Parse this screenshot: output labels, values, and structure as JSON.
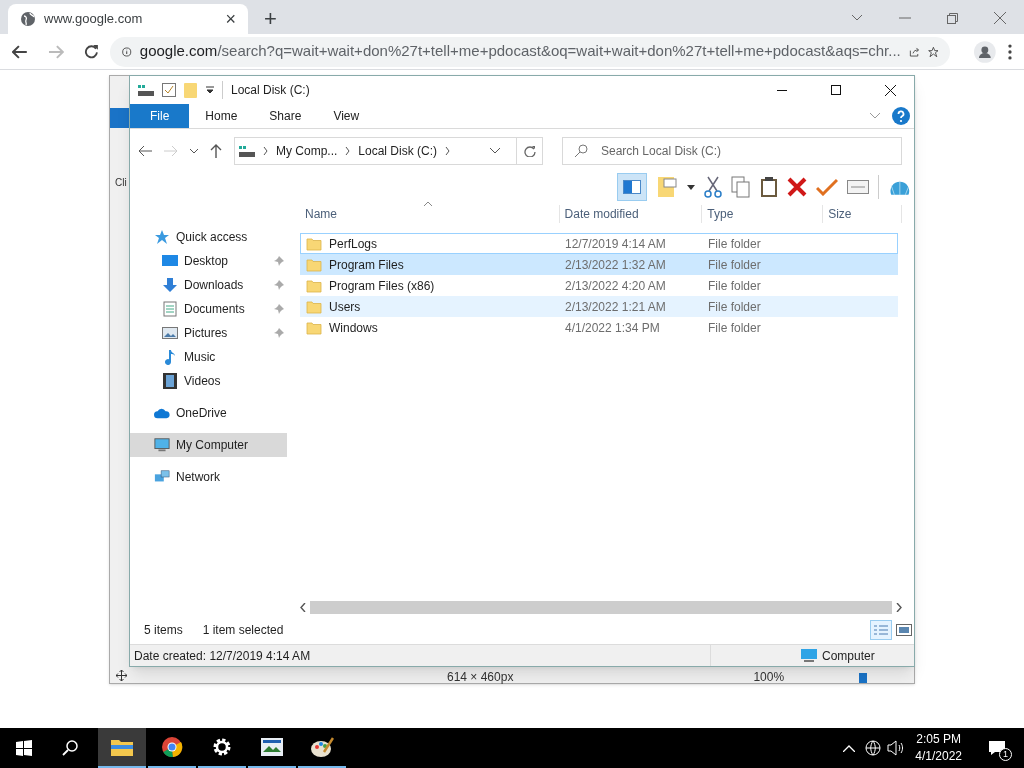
{
  "browser": {
    "tab_title": "www.google.com",
    "tab_close": "×",
    "new_tab": "+",
    "address": "google.com",
    "address_rest": "/search?q=wait+wait+don%27t+tell+me+pdocast&oq=wait+wait+don%27t+tell+me+pdocast&aqs=chr..."
  },
  "background_app": {
    "cut_label": "Cli",
    "size": "614 × 460px",
    "zoom": "100%",
    "zoom_slider": {
      "level": 0.55
    }
  },
  "explorer": {
    "title": "Local Disk (C:)",
    "ribbon_tabs": [
      {
        "label": "File",
        "selected": true
      },
      {
        "label": "Home",
        "selected": false
      },
      {
        "label": "Share",
        "selected": false
      },
      {
        "label": "View",
        "selected": false
      }
    ],
    "breadcrumb": [
      "My Comp...",
      "Local Disk (C:)"
    ],
    "search": {
      "placeholder": "Search Local Disk (C:)"
    },
    "nav": [
      {
        "label": "Quick access",
        "kind": "star",
        "pinned": false,
        "selected": false,
        "group": true
      },
      {
        "label": "Desktop",
        "kind": "desktop",
        "pinned": true,
        "selected": false,
        "group": false
      },
      {
        "label": "Downloads",
        "kind": "download",
        "pinned": true,
        "selected": false,
        "group": false
      },
      {
        "label": "Documents",
        "kind": "document",
        "pinned": true,
        "selected": false,
        "group": false
      },
      {
        "label": "Pictures",
        "kind": "pictures",
        "pinned": true,
        "selected": false,
        "group": false
      },
      {
        "label": "Music",
        "kind": "music",
        "pinned": false,
        "selected": false,
        "group": false
      },
      {
        "label": "Videos",
        "kind": "video",
        "pinned": false,
        "selected": false,
        "group": false
      },
      {
        "label": "OneDrive",
        "kind": "cloud",
        "pinned": false,
        "selected": false,
        "group": true
      },
      {
        "label": "My Computer",
        "kind": "computer",
        "pinned": false,
        "selected": true,
        "group": true
      },
      {
        "label": "Network",
        "kind": "network",
        "pinned": false,
        "selected": false,
        "group": true
      }
    ],
    "columns": [
      "Name",
      "Date modified",
      "Type",
      "Size"
    ],
    "rows": [
      {
        "name": "PerfLogs",
        "date": "12/7/2019 4:14 AM",
        "type": "File folder",
        "selected": false,
        "focused": true,
        "hovered": false
      },
      {
        "name": "Program Files",
        "date": "2/13/2022 1:32 AM",
        "type": "File folder",
        "selected": true,
        "focused": false,
        "hovered": false
      },
      {
        "name": "Program Files (x86)",
        "date": "2/13/2022 4:20 AM",
        "type": "File folder",
        "selected": false,
        "focused": false,
        "hovered": false
      },
      {
        "name": "Users",
        "date": "2/13/2022 1:21 AM",
        "type": "File folder",
        "selected": false,
        "focused": false,
        "hovered": true
      },
      {
        "name": "Windows",
        "date": "4/1/2022 1:34 PM",
        "type": "File folder",
        "selected": false,
        "focused": false,
        "hovered": false
      }
    ],
    "item_count": "5 items",
    "selection": "1 item selected",
    "details": "Date created: 12/7/2019 4:14 AM",
    "location": "Computer"
  },
  "taskbar": {
    "apps": [
      {
        "kind": "folder",
        "active": true
      },
      {
        "kind": "chrome",
        "active": false
      },
      {
        "kind": "gear",
        "active": false
      },
      {
        "kind": "viewer",
        "active": false
      },
      {
        "kind": "paint",
        "active": false
      }
    ],
    "time": "2:05 PM",
    "date": "4/1/2022",
    "notifications": "1"
  }
}
